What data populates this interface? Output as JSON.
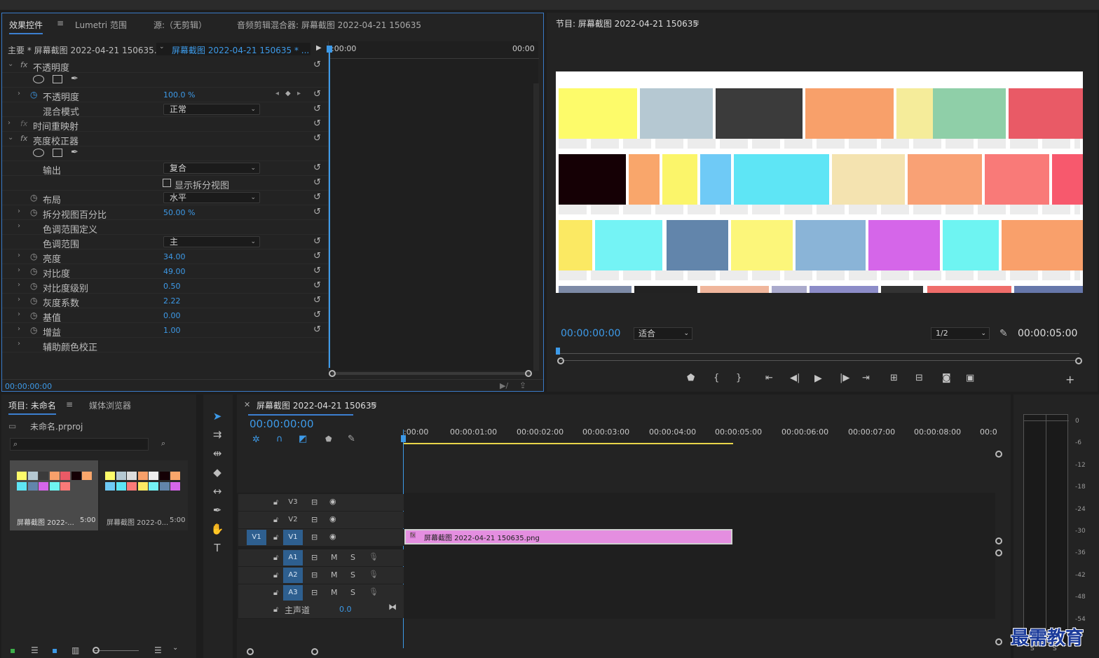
{
  "effect_controls": {
    "tabs": [
      "效果控件",
      "Lumetri 范围",
      "源:（无剪辑）",
      "音频剪辑混合器: 屏幕截图 2022-04-21 150635"
    ],
    "menu_glyph": "≡",
    "master_label": "主要 * 屏幕截图 2022-04-21 150635...",
    "clip_label": "屏幕截图 2022-04-21 150635 * ...",
    "timecode_start": ":00:00",
    "timecode_end": "00:00",
    "footer_timecode": "00:00:00:00",
    "fx_symbol": "fx",
    "rows": [
      {
        "label": "不透明度",
        "kind": "fx",
        "value": ""
      },
      {
        "label": "",
        "kind": "masks",
        "value": ""
      },
      {
        "label": "不透明度",
        "kind": "param",
        "value": "100.0 %"
      },
      {
        "label": "混合模式",
        "kind": "dropdown",
        "value": "正常"
      },
      {
        "label": "时间重映射",
        "kind": "fx-dim",
        "value": ""
      },
      {
        "label": "亮度校正器",
        "kind": "fx",
        "value": ""
      },
      {
        "label": "",
        "kind": "masks",
        "value": ""
      },
      {
        "label": "输出",
        "kind": "dropdown",
        "value": "复合"
      },
      {
        "label": "显示拆分视图",
        "kind": "checkbox",
        "value": ""
      },
      {
        "label": "布局",
        "kind": "dropdown-sw",
        "value": "水平"
      },
      {
        "label": "拆分视图百分比",
        "kind": "param",
        "value": "50.00 %"
      },
      {
        "label": "色调范围定义",
        "kind": "group",
        "value": ""
      },
      {
        "label": "色调范围",
        "kind": "dropdown",
        "value": "主"
      },
      {
        "label": "亮度",
        "kind": "param",
        "value": "34.00"
      },
      {
        "label": "对比度",
        "kind": "param",
        "value": "49.00"
      },
      {
        "label": "对比度级别",
        "kind": "param",
        "value": "0.50"
      },
      {
        "label": "灰度系数",
        "kind": "param",
        "value": "2.22"
      },
      {
        "label": "基值",
        "kind": "param",
        "value": "0.00"
      },
      {
        "label": "增益",
        "kind": "param",
        "value": "1.00"
      },
      {
        "label": "辅助颜色校正",
        "kind": "group",
        "value": ""
      }
    ]
  },
  "program": {
    "title": "节目: 屏幕截图 2022-04-21 150635",
    "timecode": "00:00:00:00",
    "fit": "适合",
    "resolution": "1/2",
    "duration": "00:00:05:00"
  },
  "project": {
    "tabs": [
      "项目: 未命名",
      "媒体浏览器"
    ],
    "file": "未命名.prproj",
    "items": [
      {
        "name": "屏幕截图 2022-...",
        "duration": "5:00"
      },
      {
        "name": "屏幕截图 2022-0...",
        "duration": "5:00"
      }
    ]
  },
  "timeline": {
    "title": "屏幕截图 2022-04-21 150635",
    "timecode": "00:00:00:00",
    "ruler": [
      ":00:00",
      "00:00:01:00",
      "00:00:02:00",
      "00:00:03:00",
      "00:00:04:00",
      "00:00:05:00",
      "00:00:06:00",
      "00:00:07:00",
      "00:00:08:00",
      "00:0"
    ],
    "video_tracks": [
      "V3",
      "V2",
      "V1"
    ],
    "audio_tracks": [
      "A1",
      "A2",
      "A3"
    ],
    "source_v": "V1",
    "master": "主声道",
    "master_value": "0.0",
    "clip_name": "屏幕截图 2022-04-21  150635.png",
    "mute": "M",
    "solo": "S"
  },
  "meter": {
    "labels": [
      "0",
      "-6",
      "-12",
      "-18",
      "-24",
      "-30",
      "-36",
      "-42",
      "-48",
      "-54"
    ],
    "solo_label": "S"
  },
  "watermark": "最需教育",
  "colors": {
    "accent": "#3d9ae8",
    "clip": "#e48ee0",
    "work_area": "#e8d54a"
  }
}
